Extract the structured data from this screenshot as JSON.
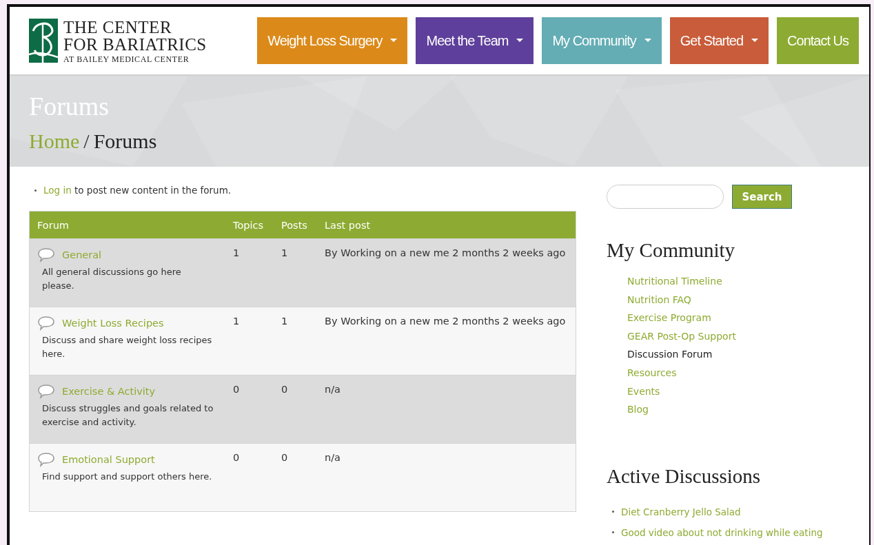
{
  "logo": {
    "lines": [
      "THE CENTER",
      "FOR BARIATRICS",
      "AT BAILEY MEDICAL CENTER"
    ]
  },
  "nav": [
    {
      "label": "Weight Loss Surgery",
      "color": "#db8a1a",
      "dropdown": true
    },
    {
      "label": "Meet the Team",
      "color": "#5e3f9b",
      "dropdown": true
    },
    {
      "label": "My Community",
      "color": "#64adb4",
      "dropdown": true
    },
    {
      "label": "Get Started",
      "color": "#c95c3a",
      "dropdown": true
    },
    {
      "label": "Contact Us",
      "color": "#8dab32",
      "dropdown": false
    }
  ],
  "banner": {
    "title": "Forums",
    "breadcrumb": [
      {
        "label": "Home",
        "link": true
      },
      {
        "label": "Forums",
        "link": false
      }
    ],
    "separator": "/"
  },
  "notice": {
    "link": "Log in",
    "text": "to post new content in the forum."
  },
  "table": {
    "columns": [
      "Forum",
      "Topics",
      "Posts",
      "Last post"
    ],
    "rows": [
      {
        "name": "General",
        "description": "All general discussions go here please.",
        "topics": "1",
        "posts": "1",
        "last_post": "By Working on a new me 2 months 2 weeks ago"
      },
      {
        "name": "Weight Loss Recipes",
        "description": "Discuss and share weight loss recipes here.",
        "topics": "1",
        "posts": "1",
        "last_post": "By Working on a new me 2 months 2 weeks ago"
      },
      {
        "name": "Exercise & Activity",
        "description": "Discuss struggles and goals related to exercise and activity.",
        "topics": "0",
        "posts": "0",
        "last_post": "n/a"
      },
      {
        "name": "Emotional Support",
        "description": "Find support and support others here.",
        "topics": "0",
        "posts": "0",
        "last_post": "n/a"
      }
    ]
  },
  "sidebar": {
    "search_button": "Search",
    "community": {
      "title": "My Community",
      "items": [
        {
          "label": "Nutritional Timeline",
          "selected": false
        },
        {
          "label": "Nutrition FAQ",
          "selected": false
        },
        {
          "label": "Exercise Program",
          "selected": false
        },
        {
          "label": "GEAR Post-Op Support",
          "selected": false
        },
        {
          "label": "Discussion Forum",
          "selected": true
        },
        {
          "label": "Resources",
          "selected": false
        },
        {
          "label": "Events",
          "selected": false
        },
        {
          "label": "Blog",
          "selected": false
        }
      ]
    },
    "active": {
      "title": "Active Discussions",
      "items": [
        "Diet Cranberry Jello Salad",
        "Good video about not drinking while eating"
      ]
    }
  }
}
